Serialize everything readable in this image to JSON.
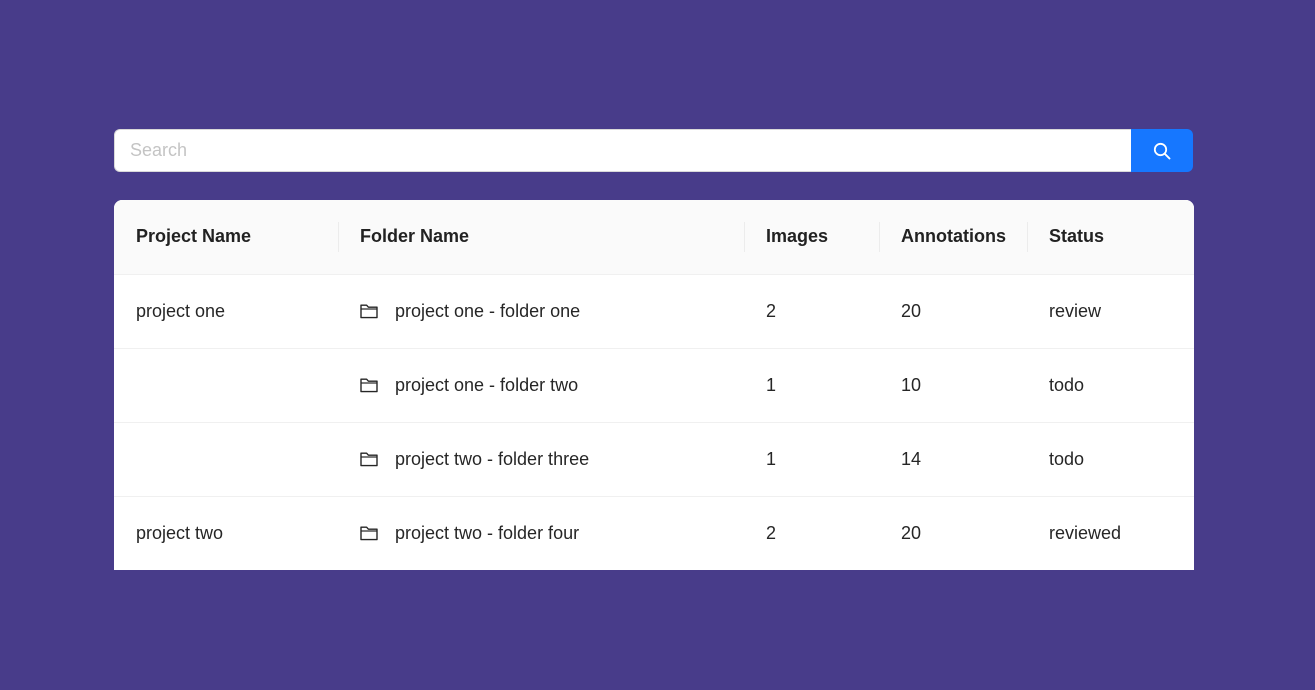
{
  "search": {
    "placeholder": "Search",
    "value": "",
    "button_icon": "search-icon",
    "button_color": "#1677ff"
  },
  "colors": {
    "background": "#483c8a",
    "table_header": "#fafafa",
    "table_body": "#ffffff"
  },
  "table": {
    "columns": [
      "Project Name",
      "Folder Name",
      "Images",
      "Annotations",
      "Status"
    ],
    "rows": [
      {
        "project": "project one",
        "folder": "project one - folder one",
        "folder_icon": "folder-icon",
        "images": "2",
        "annotations": "20",
        "status": "review"
      },
      {
        "project": "",
        "folder": "project one - folder two",
        "folder_icon": "folder-icon",
        "images": "1",
        "annotations": "10",
        "status": "todo"
      },
      {
        "project": "",
        "folder": "project two - folder three",
        "folder_icon": "folder-icon",
        "images": "1",
        "annotations": "14",
        "status": "todo"
      },
      {
        "project": "project two",
        "folder": "project two - folder four",
        "folder_icon": "folder-icon",
        "images": "2",
        "annotations": "20",
        "status": "reviewed"
      }
    ]
  }
}
